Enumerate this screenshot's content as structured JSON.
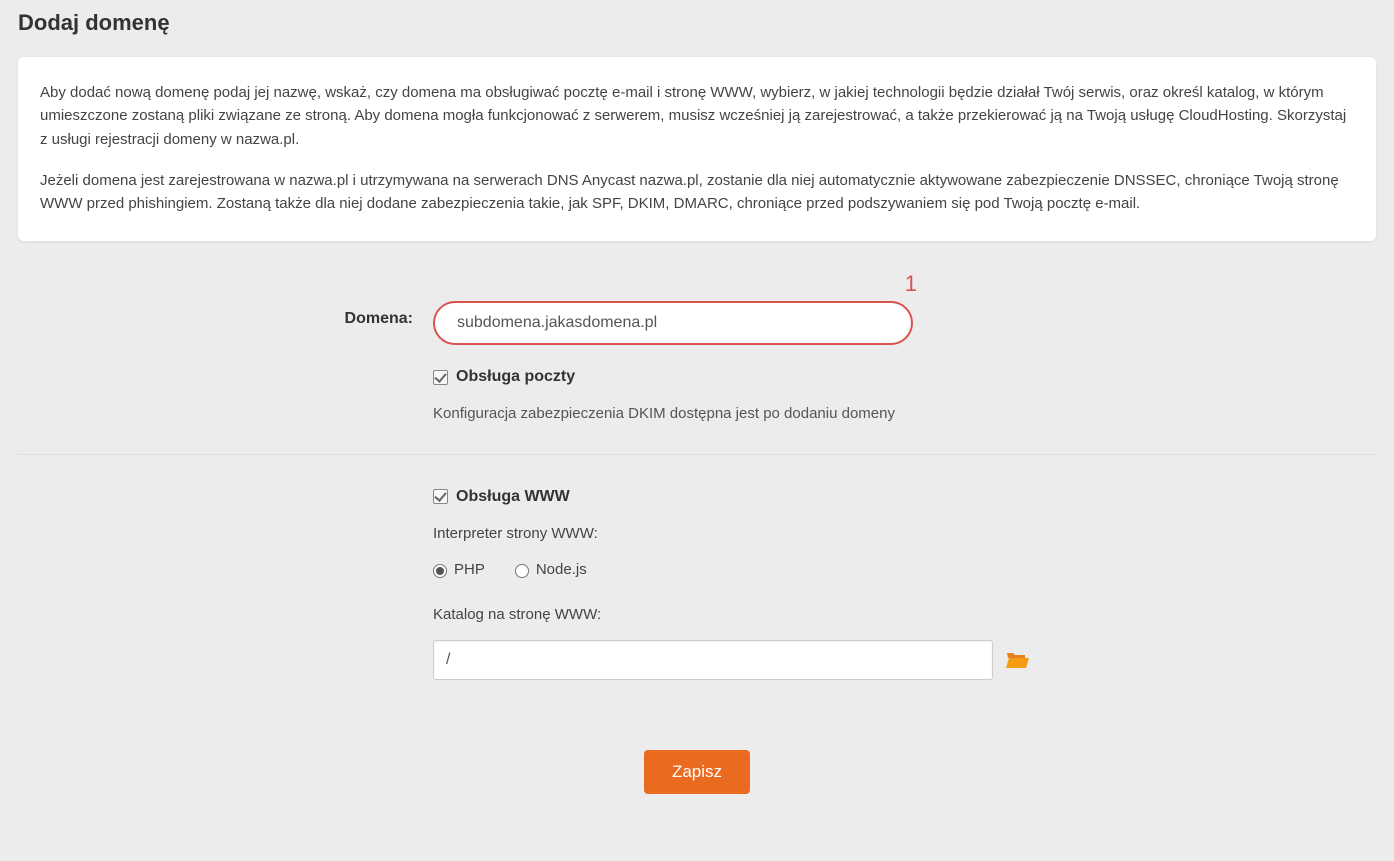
{
  "page": {
    "title": "Dodaj domenę",
    "info_paragraph_1": "Aby dodać nową domenę podaj jej nazwę, wskaż, czy domena ma obsługiwać pocztę e-mail i stronę WWW, wybierz, w jakiej technologii będzie działał Twój serwis, oraz określ katalog, w którym umieszczone zostaną pliki związane ze stroną. Aby domena mogła funkcjonować z serwerem, musisz wcześniej ją zarejestrować, a także przekierować ją na Twoją usługę CloudHosting. Skorzystaj z usługi rejestracji domeny w nazwa.pl.",
    "info_paragraph_2": "Jeżeli domena jest zarejestrowana w nazwa.pl i utrzymywana na serwerach DNS Anycast nazwa.pl, zostanie dla niej automatycznie aktywowane zabezpieczenie DNSSEC, chroniące Twoją stronę WWW przed phishingiem. Zostaną także dla niej dodane zabezpieczenia takie, jak SPF, DKIM, DMARC, chroniące przed podszywaniem się pod Twoją pocztę e-mail."
  },
  "form": {
    "domain_label": "Domena:",
    "domain_value": "subdomena.jakasdomena.pl",
    "annotation_number": "1",
    "mail_support_label": "Obsługa poczty",
    "mail_support_checked": true,
    "mail_helper": "Konfiguracja zabezpieczenia DKIM dostępna jest po dodaniu domeny",
    "www_support_label": "Obsługa WWW",
    "www_support_checked": true,
    "interpreter_label": "Interpreter strony WWW:",
    "interpreter_options": {
      "php": "PHP",
      "nodejs": "Node.js"
    },
    "interpreter_selected": "php",
    "directory_label": "Katalog na stronę WWW:",
    "directory_value": "/",
    "submit_label": "Zapisz"
  }
}
